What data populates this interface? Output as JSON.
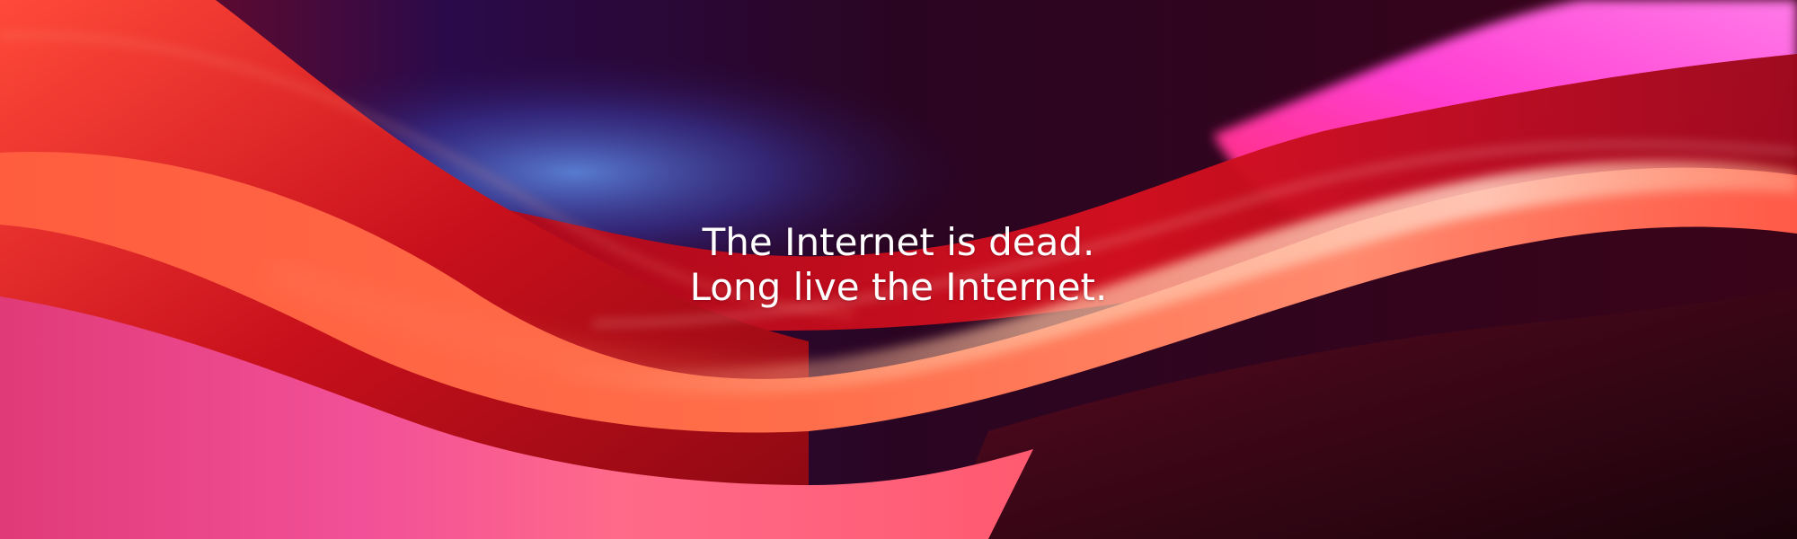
{
  "banner": {
    "line1": "The Internet is dead.",
    "line2": "Long live the Internet."
  },
  "colors": {
    "deep_purple": "#1c0a3a",
    "blue_glow": "#4a6ec8",
    "wine": "#5a0a1e",
    "crimson": "#c0101e",
    "orange_red": "#ff5a3a",
    "coral": "#ff8a6a",
    "magenta": "#ff3fd2",
    "pink": "#f0509a",
    "dark_maroon": "#24040f"
  }
}
